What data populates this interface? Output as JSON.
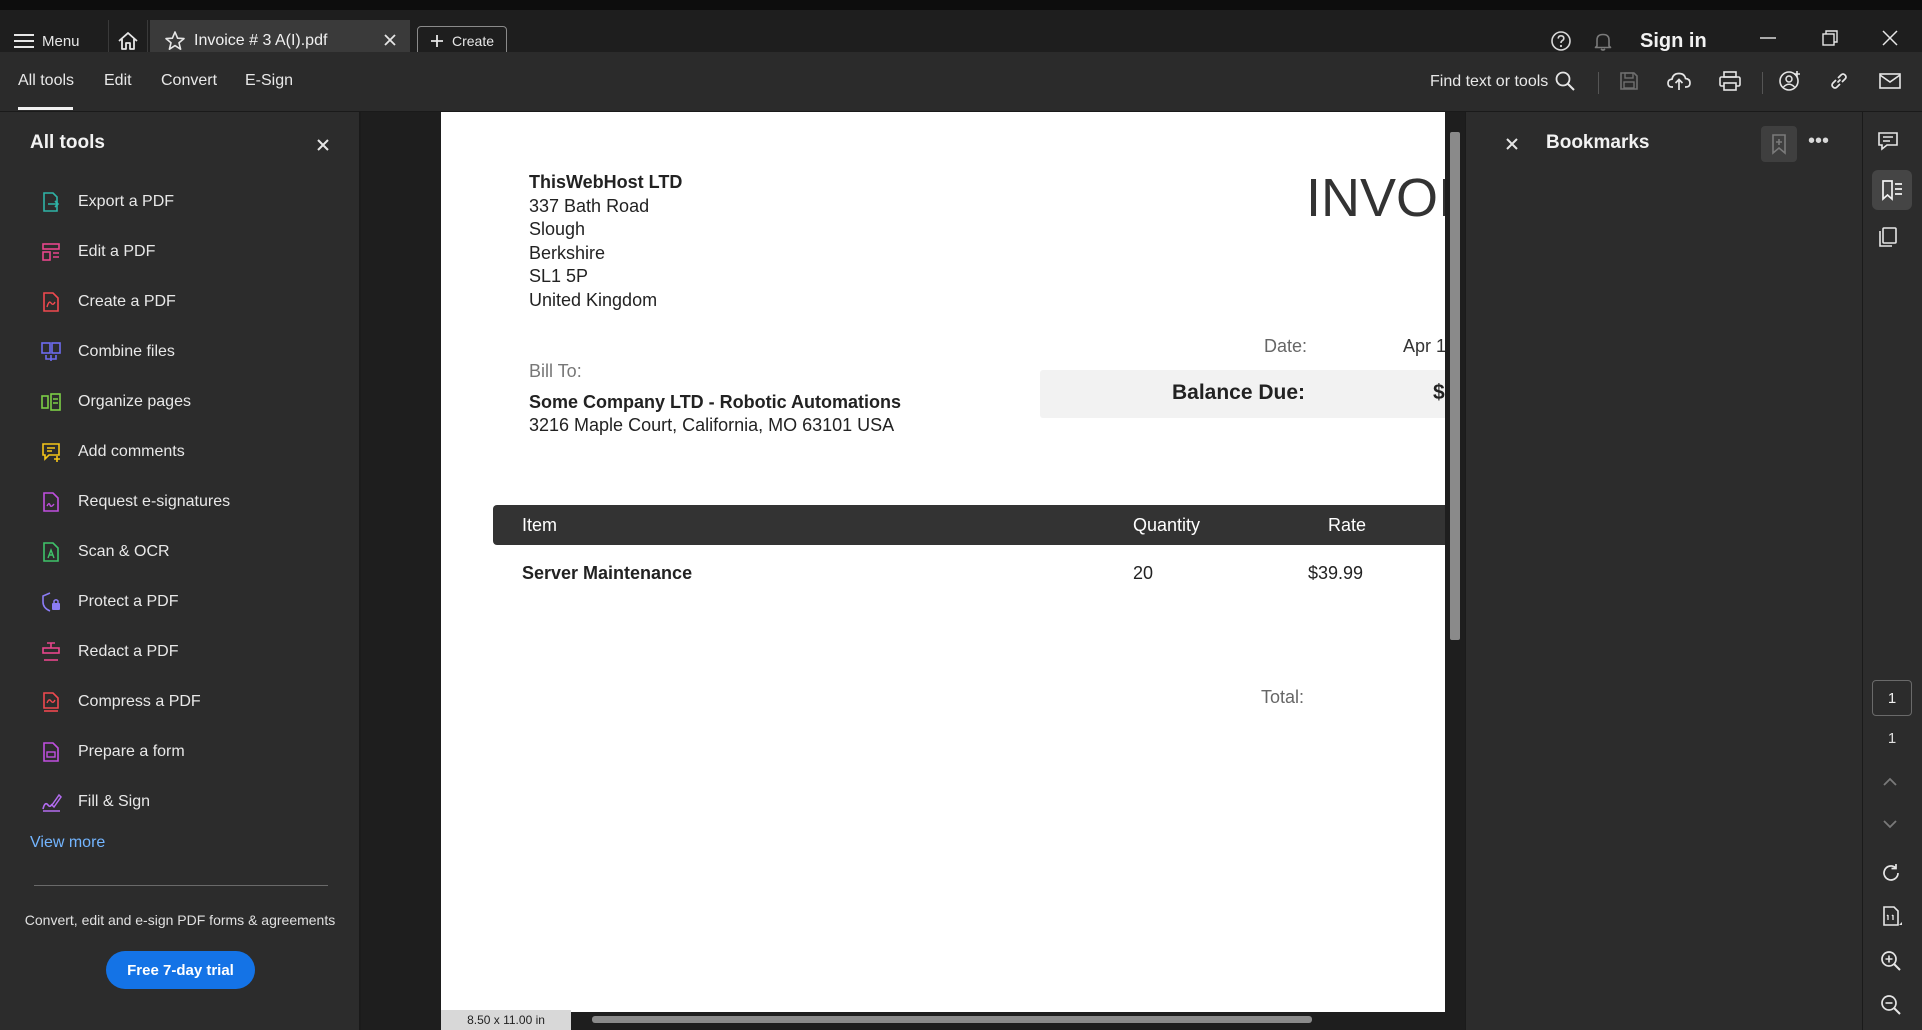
{
  "titlebar": {
    "menu_label": "Menu",
    "tab_label": "Invoice # 3 A(I).pdf",
    "create_label": "Create",
    "signin_label": "Sign in"
  },
  "toolbar": {
    "tabs": [
      "All tools",
      "Edit",
      "Convert",
      "E-Sign"
    ],
    "find_label": "Find text or tools"
  },
  "left_panel": {
    "title": "All tools",
    "items": [
      {
        "label": "Export a PDF",
        "icon": "export-pdf-icon",
        "color": "#2fb3a6"
      },
      {
        "label": "Edit a PDF",
        "icon": "edit-pdf-icon",
        "color": "#e8458c"
      },
      {
        "label": "Create a PDF",
        "icon": "create-pdf-icon",
        "color": "#f0494f"
      },
      {
        "label": "Combine files",
        "icon": "combine-files-icon",
        "color": "#6e6cf0"
      },
      {
        "label": "Organize pages",
        "icon": "organize-pages-icon",
        "color": "#7ccf46"
      },
      {
        "label": "Add comments",
        "icon": "add-comments-icon",
        "color": "#f5c518"
      },
      {
        "label": "Request e-signatures",
        "icon": "request-esignatures-icon",
        "color": "#c04fe0"
      },
      {
        "label": "Scan & OCR",
        "icon": "scan-ocr-icon",
        "color": "#3fc36a"
      },
      {
        "label": "Protect a PDF",
        "icon": "protect-pdf-icon",
        "color": "#8b7cf5"
      },
      {
        "label": "Redact a PDF",
        "icon": "redact-pdf-icon",
        "color": "#e8458c"
      },
      {
        "label": "Compress a PDF",
        "icon": "compress-pdf-icon",
        "color": "#f0494f"
      },
      {
        "label": "Prepare a form",
        "icon": "prepare-form-icon",
        "color": "#c04fe0"
      },
      {
        "label": "Fill & Sign",
        "icon": "fill-sign-icon",
        "color": "#b36cf0"
      }
    ],
    "view_more": "View more",
    "promo_text": "Convert, edit and e-sign PDF forms & agreements",
    "trial_button": "Free 7-day trial"
  },
  "document": {
    "company": "ThisWebHost LTD",
    "address_lines": [
      "337 Bath Road",
      "Slough",
      "Berkshire",
      "SL1 5P",
      "United Kingdom"
    ],
    "invoice_title": "INVOI",
    "date_label": "Date:",
    "date_value": "Apr 1",
    "balance_label": "Balance Due:",
    "balance_value": "$",
    "bill_to_label": "Bill To:",
    "bill_to_name": "Some Company LTD - Robotic Automations",
    "bill_to_address": "3216 Maple Court, California, MO 63101 USA",
    "table_headers": [
      "Item",
      "Quantity",
      "Rate"
    ],
    "rows": [
      {
        "item": "Server Maintenance",
        "quantity": "20",
        "rate": "$39.99"
      }
    ],
    "total_label": "Total:",
    "page_size": "8.50 x 11.00 in"
  },
  "bookmarks": {
    "title": "Bookmarks"
  },
  "right_rail": {
    "current_page": "1",
    "total_pages": "1"
  },
  "colors": {
    "accent": "#1473e6",
    "link": "#73b5ff"
  }
}
